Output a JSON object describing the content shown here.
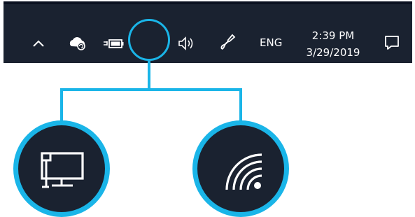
{
  "taskbar": {
    "icons": {
      "chevron": "chevron-up-icon",
      "cloud": "onedrive-cloud-icon",
      "battery": "battery-plug-icon",
      "network": "network-icon",
      "volume": "volume-icon",
      "pen": "windows-ink-pen-icon",
      "notifications": "action-center-icon"
    },
    "language": "ENG",
    "time": "2:39 PM",
    "date": "3/29/2019"
  },
  "callout": {
    "highlight_color": "#1ab5e8",
    "options": [
      {
        "icon": "wired-ethernet-icon"
      },
      {
        "icon": "wifi-icon"
      }
    ]
  },
  "colors": {
    "taskbar_bg": "#1a2230",
    "accent": "#1ab5e8",
    "icon": "#ffffff"
  }
}
